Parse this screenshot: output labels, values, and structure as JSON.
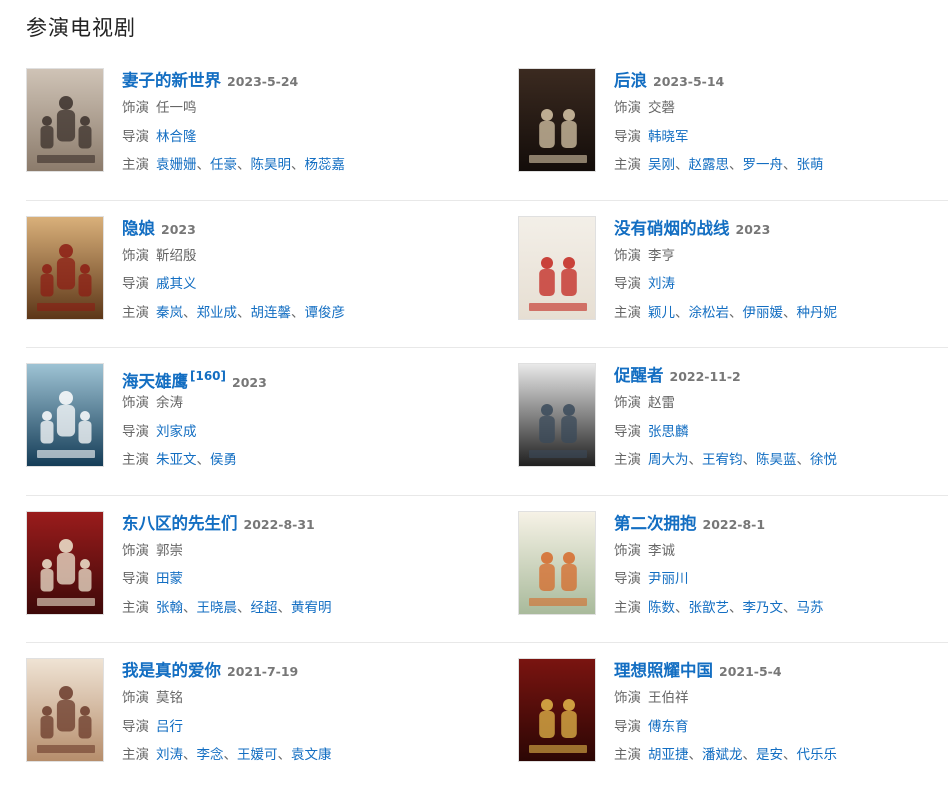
{
  "section": {
    "title": "参演电视剧"
  },
  "labels": {
    "role": "饰演",
    "director": "导演",
    "cast": "主演"
  },
  "dramas": [
    {
      "title": "妻子的新世界",
      "ref": "",
      "date": "2023-5-24",
      "role": "任一鸣",
      "director": "林合隆",
      "cast": [
        "袁姗姗",
        "任豪",
        "陈昊明",
        "杨蕊嘉"
      ],
      "poster": {
        "name": "qizi-poster",
        "bg1": "#cfc3b6",
        "bg2": "#8a7a6a",
        "accent": "#3a2f2a"
      }
    },
    {
      "title": "后浪",
      "ref": "",
      "date": "2023-5-14",
      "role": "交磬",
      "director": "韩晓军",
      "cast": [
        "吴刚",
        "赵露思",
        "罗一舟",
        "张萌"
      ],
      "poster": {
        "name": "houlang-poster",
        "bg1": "#3b2a20",
        "bg2": "#120c09",
        "accent": "#d8c7a8"
      }
    },
    {
      "title": "隐娘",
      "ref": "",
      "date": "2023",
      "role": "靳绍殷",
      "director": "戚其义",
      "cast": [
        "秦岚",
        "郑业成",
        "胡连馨",
        "谭俊彦"
      ],
      "poster": {
        "name": "yinniang-poster",
        "bg1": "#d9b07a",
        "bg2": "#5a3416",
        "accent": "#8c1d14"
      }
    },
    {
      "title": "没有硝烟的战线",
      "ref": "",
      "date": "2023",
      "role": "李亨",
      "director": "刘涛",
      "cast": [
        "颖儿",
        "涂松岩",
        "伊丽媛",
        "种丹妮"
      ],
      "poster": {
        "name": "xiaoyan-poster",
        "bg1": "#f3efe8",
        "bg2": "#e6ded2",
        "accent": "#c2241d"
      }
    },
    {
      "title": "海天雄鹰",
      "ref": "[160]",
      "date": "2023",
      "role": "余涛",
      "director": "刘家成",
      "cast": [
        "朱亚文",
        "侯勇"
      ],
      "poster": {
        "name": "haitian-poster",
        "bg1": "#9ec3d4",
        "bg2": "#123a55",
        "accent": "#ffffff"
      }
    },
    {
      "title": "促醒者",
      "ref": "",
      "date": "2022-11-2",
      "role": "赵雷",
      "director": "张思麟",
      "cast": [
        "周大为",
        "王宥钧",
        "陈昊蓝",
        "徐悦"
      ],
      "poster": {
        "name": "cuxing-poster",
        "bg1": "#e9e9e9",
        "bg2": "#1c1c1c",
        "accent": "#3a4a5a"
      }
    },
    {
      "title": "东八区的先生们",
      "ref": "",
      "date": "2022-8-31",
      "role": "郭崇",
      "director": "田蒙",
      "cast": [
        "张翰",
        "王晓晨",
        "经超",
        "黄宥明"
      ],
      "poster": {
        "name": "dongbaqu-poster",
        "bg1": "#9a1c1c",
        "bg2": "#3c0808",
        "accent": "#f0e6d0"
      }
    },
    {
      "title": "第二次拥抱",
      "ref": "",
      "date": "2022-8-1",
      "role": "李诚",
      "director": "尹丽川",
      "cast": [
        "陈数",
        "张歆艺",
        "李乃文",
        "马苏"
      ],
      "poster": {
        "name": "dierci-poster",
        "bg1": "#f6f2e6",
        "bg2": "#a7b99a",
        "accent": "#d66a2a"
      }
    },
    {
      "title": "我是真的爱你",
      "ref": "",
      "date": "2021-7-19",
      "role": "莫铭",
      "director": "吕行",
      "cast": [
        "刘涛",
        "李念",
        "王媛可",
        "袁文康"
      ],
      "poster": {
        "name": "woshi-poster",
        "bg1": "#efe3d4",
        "bg2": "#b58c6a",
        "accent": "#6a3a2a"
      }
    },
    {
      "title": "理想照耀中国",
      "ref": "",
      "date": "2021-5-4",
      "role": "王伯祥",
      "director": "傅东育",
      "cast": [
        "胡亚捷",
        "潘斌龙",
        "是安",
        "代乐乐"
      ],
      "poster": {
        "name": "lixiang-poster",
        "bg1": "#7a1410",
        "bg2": "#2a0604",
        "accent": "#e3b74a"
      }
    }
  ]
}
